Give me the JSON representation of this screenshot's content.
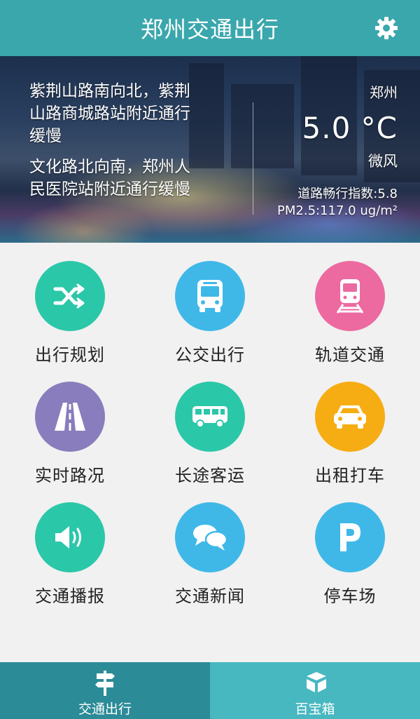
{
  "header": {
    "title": "郑州交通出行",
    "settings_icon": "gear-icon"
  },
  "banner": {
    "news": [
      "紫荆山路南向北，紫荆山路商城路站附近通行缓慢",
      "文化路北向南，郑州人民医院站附近通行缓慢"
    ],
    "weather": {
      "city": "郑州",
      "temperature": "5.0 °C",
      "wind": "微风",
      "road_index": "道路畅行指数:5.8",
      "pm25": "PM2.5:117.0 ug/m²"
    }
  },
  "tiles": [
    {
      "label": "出行规划",
      "icon": "shuffle-icon",
      "color": "#2bc7a9"
    },
    {
      "label": "公交出行",
      "icon": "bus-front-icon",
      "color": "#3fb8e8"
    },
    {
      "label": "轨道交通",
      "icon": "train-icon",
      "color": "#ec6aa0"
    },
    {
      "label": "实时路况",
      "icon": "road-icon",
      "color": "#8a7dbd"
    },
    {
      "label": "长途客运",
      "icon": "coach-bus-icon",
      "color": "#2bc7a9"
    },
    {
      "label": "出租打车",
      "icon": "taxi-icon",
      "color": "#f6ad13"
    },
    {
      "label": "交通播报",
      "icon": "speaker-icon",
      "color": "#2bc7a9"
    },
    {
      "label": "交通新闻",
      "icon": "chat-bubbles-icon",
      "color": "#3fb8e8"
    },
    {
      "label": "停车场",
      "icon": "parking-icon",
      "color": "#3fb8e8"
    }
  ],
  "bottom_nav": [
    {
      "label": "交通出行",
      "icon": "signpost-icon",
      "active": true
    },
    {
      "label": "百宝箱",
      "icon": "box-icon",
      "active": false
    }
  ]
}
